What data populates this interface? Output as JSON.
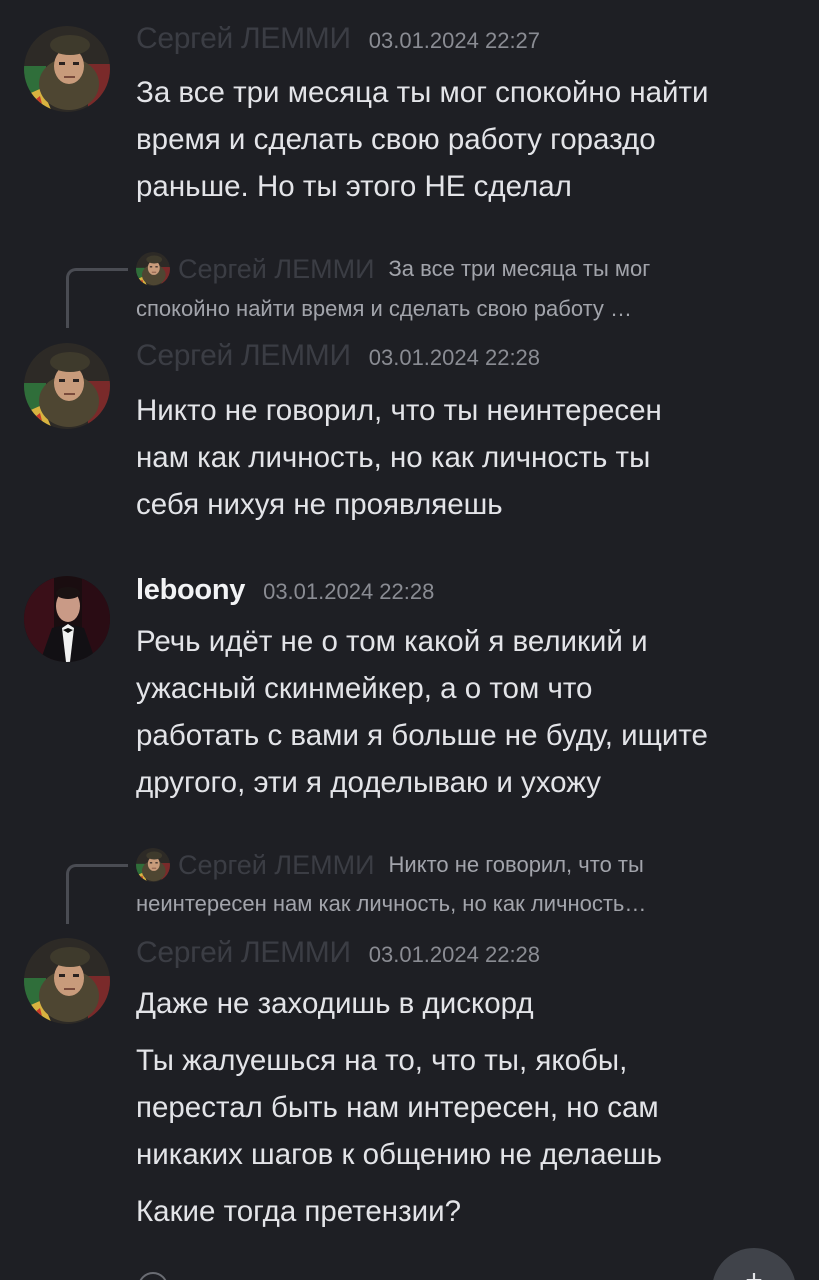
{
  "colors": {
    "background": "#1e1f24",
    "text": "#e3e4e8",
    "timestamp": "#8a8c93",
    "dim_author": "#3b3d44",
    "reply_spine": "#4a4c53",
    "fab_bg": "#40434a"
  },
  "messages": [
    {
      "author": "Сергей ЛЕММИ",
      "timestamp": "03.01.2024 22:27",
      "avatar": "soldier-avatar",
      "lines": [
        "За все три месяца ты мог спокойно найти",
        "время и сделать свою работу гораздо",
        "раньше. Но ты этого НЕ сделал"
      ]
    },
    {
      "reply": {
        "author": "Сергей ЛЕММИ",
        "text_line1": "За все три месяца ты мог",
        "text_line2": "спокойно найти время и сделать свою работу …"
      },
      "author": "Сергей ЛЕММИ",
      "timestamp": "03.01.2024 22:28",
      "avatar": "soldier-avatar",
      "lines": [
        "Никто не говорил, что ты неинтересен",
        "нам как личность, но как личность ты",
        "себя нихуя не проявляешь"
      ]
    },
    {
      "author": "leboony",
      "timestamp": "03.01.2024 22:28",
      "avatar": "tuxedo-avatar",
      "lines": [
        "Речь идёт не о том какой я великий и",
        "ужасный скинмейкер, а о том что",
        "работать с вами я больше не буду, ищите",
        "другого, эти я доделываю и ухожу"
      ]
    },
    {
      "reply": {
        "author": "Сергей ЛЕММИ",
        "text_line1": "Никто не говорил, что ты",
        "text_line2": "неинтересен нам как личность, но как личность…"
      },
      "author": "Сергей ЛЕММИ",
      "timestamp": "03.01.2024 22:28",
      "avatar": "soldier-avatar",
      "paragraphs": [
        [
          "Даже не заходишь в дискорд"
        ],
        [
          "Ты жалуешься на то, что ты, якобы,",
          "перестал быть нам интересен, но сам",
          "никаких шагов к общению не делаешь"
        ],
        [
          "Какие тогда претензии?"
        ]
      ]
    }
  ],
  "fab": {
    "icon": "plus-icon",
    "glyph": "+"
  }
}
